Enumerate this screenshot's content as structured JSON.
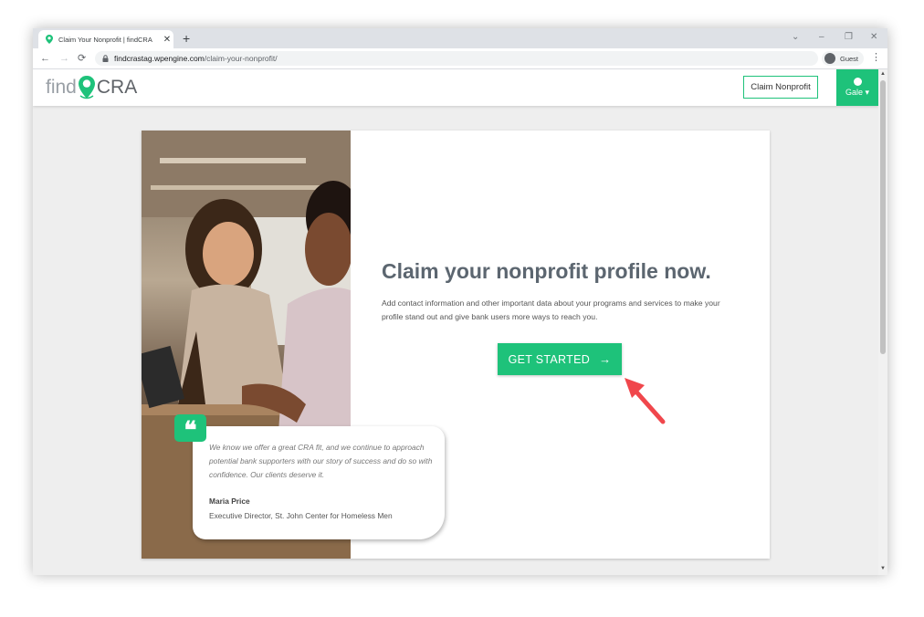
{
  "browser": {
    "tab_title": "Claim Your Nonprofit | findCRA",
    "tab_close": "✕",
    "new_tab": "+",
    "url_host": "findcrastag.wpengine.com",
    "url_path": "/claim-your-nonprofit/",
    "profile_label": "Guest",
    "window_controls": {
      "dropdown": "⌄",
      "minimize": "–",
      "restore": "❐",
      "close": "✕"
    },
    "nav": {
      "back": "←",
      "forward": "→",
      "reload": "⟳",
      "menu": "⋮"
    }
  },
  "header": {
    "logo_find": "find",
    "logo_cra": "CRA",
    "claim_button": "Claim Nonprofit",
    "user_name": "Gale ▾"
  },
  "hero": {
    "headline": "Claim your nonprofit profile now.",
    "description": "Add contact information and other important data about your programs and services to make your profile stand out and give bank users more ways to reach you.",
    "cta_label": "GET STARTED",
    "cta_arrow": "→"
  },
  "testimonial": {
    "quote_mark": "❝",
    "quote": "We know we offer a great CRA fit, and we continue to approach potential bank supporters with our story of success and do so with confidence. Our clients deserve it.",
    "name": "Maria Price",
    "role": "Executive Director, St. John Center for Homeless Men"
  },
  "colors": {
    "brand_green": "#1ec27a",
    "annotation_red": "#f0474c",
    "headline_gray": "#5c6670"
  },
  "icons": [
    "map-pin-icon",
    "lock-icon",
    "user-icon",
    "quote-icon",
    "arrow-right-icon",
    "annotation-arrow-icon"
  ]
}
